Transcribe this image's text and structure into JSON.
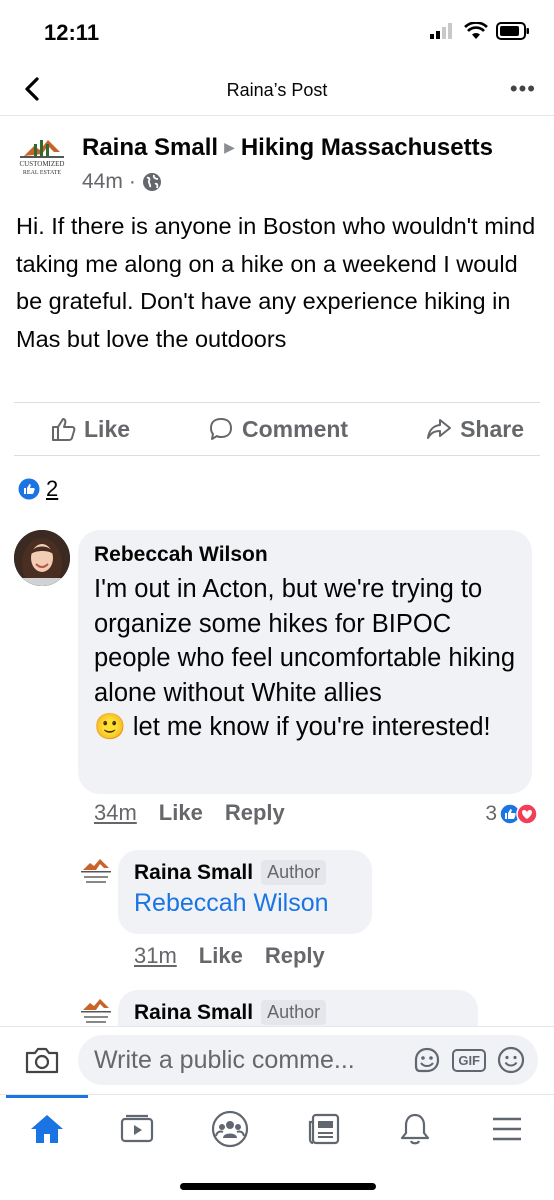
{
  "status": {
    "time": "12:11"
  },
  "nav": {
    "title": "Raina’s Post"
  },
  "post": {
    "author": "Raina Small",
    "group": "Hiking Massachusetts",
    "time": "44m",
    "avatar_text_top": "CUSTOMIZED",
    "avatar_text_bottom": "REAL ESTATE",
    "text": "Hi. If there is anyone in Boston who wouldn't mind taking me along on a hike on a weekend I would be grateful. Don't have any experience hiking  in Mas but love the outdoors"
  },
  "actions": {
    "like": "Like",
    "comment": "Comment",
    "share": "Share"
  },
  "reactions": {
    "count": "2"
  },
  "comment": {
    "author": "Rebeccah Wilson",
    "text_1": "I'm out in Acton, but we're trying to organize some hikes for BIPOC people who feel uncomfortable hiking alone without White allies",
    "emoji": "🙂",
    "text_2": "let me know if you're interested!",
    "time": "34m",
    "like": "Like",
    "reply": "Reply",
    "reaction_count": "3"
  },
  "reply1": {
    "author": "Raina Small",
    "badge": "Author",
    "mention": "Rebeccah Wilson",
    "time": "31m",
    "like": "Like",
    "reply": "Reply"
  },
  "reply2": {
    "author": "Raina Small",
    "badge": "Author"
  },
  "composer": {
    "placeholder": "Write a public comme...",
    "gif": "GIF"
  },
  "tabs": [
    "home-icon",
    "watch-icon",
    "groups-icon",
    "news-icon",
    "notifications-icon",
    "menu-icon"
  ],
  "colors": {
    "accent": "#1b74e4",
    "love": "#f33e58"
  }
}
